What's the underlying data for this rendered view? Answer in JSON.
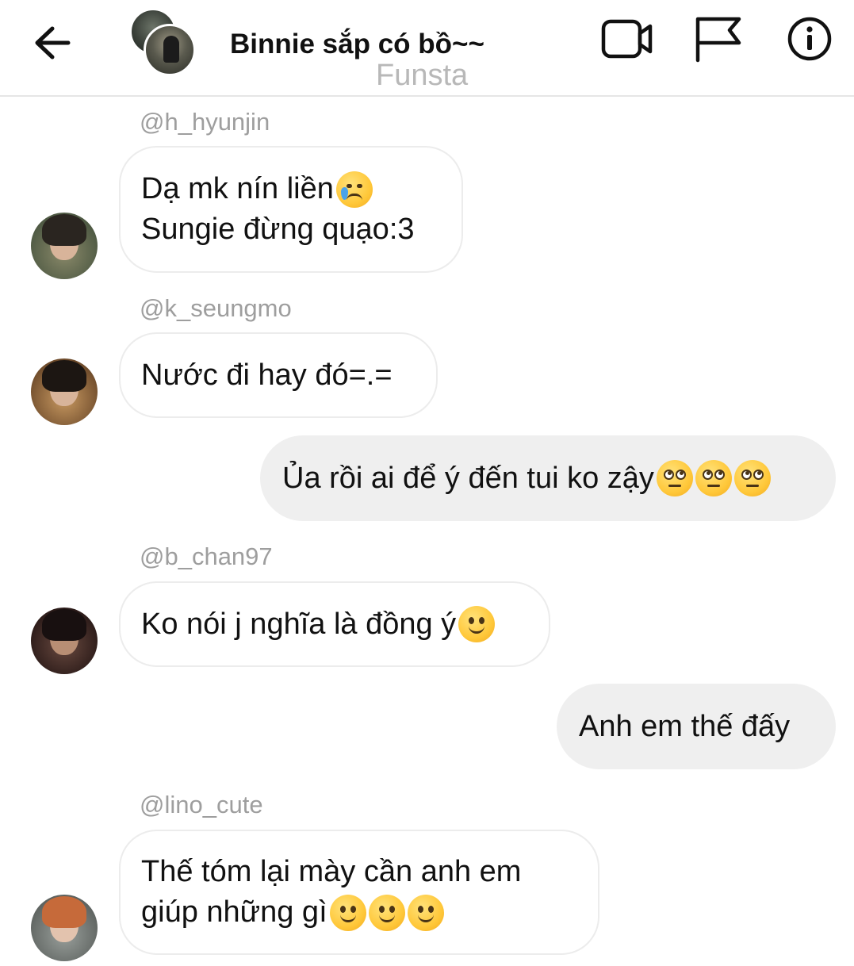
{
  "header": {
    "title": "Binnie sắp có bồ~~",
    "subtitle": "Funsta",
    "back_icon": "arrow-left-icon",
    "video_icon": "video-camera-icon",
    "flag_icon": "flag-icon",
    "info_icon": "info-icon"
  },
  "messages": [
    {
      "direction": "incoming",
      "sender": "@h_hyunjin",
      "lines": [
        "Dạ mk nín liền",
        "Sungie đừng quạo:3"
      ],
      "emoji": "crying-face"
    },
    {
      "direction": "incoming",
      "sender": "@k_seungmo",
      "lines": [
        "Nước đi hay đó=.="
      ]
    },
    {
      "direction": "outgoing",
      "text": "Ủa rồi ai để ý đến tui ko zậy",
      "emoji": "face-with-rolling-eyes",
      "emoji_count": 3
    },
    {
      "direction": "incoming",
      "sender": "@b_chan97",
      "lines": [
        "Ko nói j nghĩa là đồng ý"
      ],
      "emoji": "slightly-smiling-face"
    },
    {
      "direction": "outgoing",
      "text": "Anh em thế đấy"
    },
    {
      "direction": "incoming",
      "sender": "@lino_cute",
      "lines": [
        "Thế tóm lại mày cần anh em",
        "giúp những gì"
      ],
      "emoji": "slightly-smiling-face",
      "emoji_count": 3
    }
  ],
  "colors": {
    "incoming_bubble_border": "#ececec",
    "outgoing_bubble_bg": "#efefef",
    "sender_text": "#9e9e9e",
    "subtitle_text": "#b8b8b8"
  }
}
